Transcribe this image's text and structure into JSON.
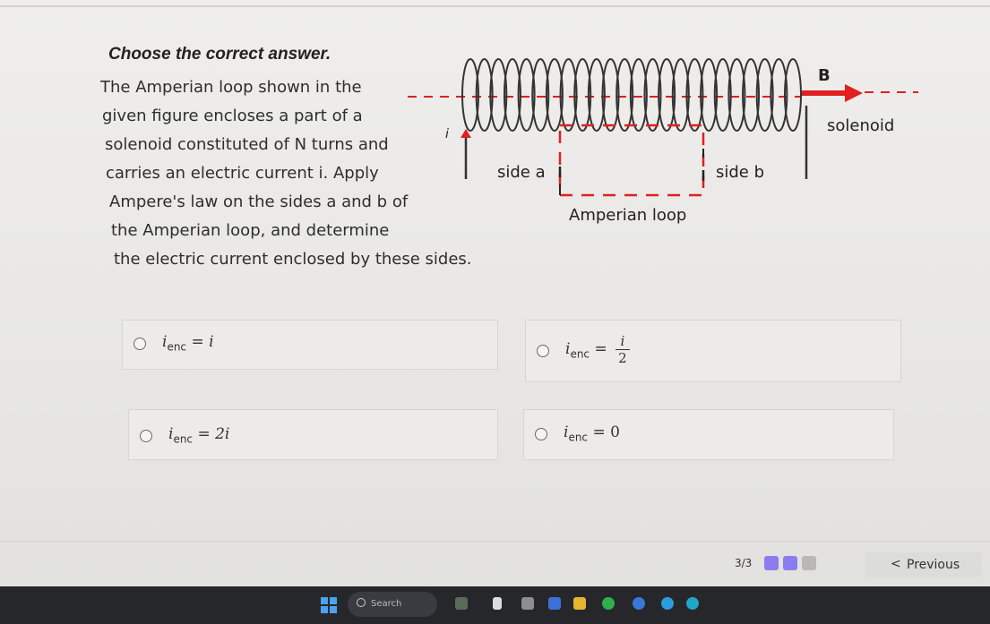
{
  "question": {
    "title": "Choose the correct answer.",
    "lines": [
      "The Amperian loop shown in the",
      "given figure encloses a part of a",
      "solenoid constituted of N turns and",
      "carries an electric current i. Apply",
      "Ampere's law on the sides a and b of",
      "the Amperian loop, and determine",
      "the electric current enclosed by these sides."
    ]
  },
  "figure": {
    "field_label": "B",
    "solenoid_label": "solenoid",
    "current_label": "i",
    "side_a_label": "side a",
    "side_b_label": "side b",
    "loop_label": "Amperian loop",
    "colors": {
      "coil": "#333333",
      "arrow": "#e02020",
      "loop": "#e02020",
      "field_line": "#e02020"
    }
  },
  "options": [
    {
      "sym": "i",
      "sub": "enc",
      "eq": "= i"
    },
    {
      "sym": "i",
      "sub": "enc",
      "eq": "=",
      "num": "i",
      "den": "2"
    },
    {
      "sym": "i",
      "sub": "enc",
      "eq": "= 2i"
    },
    {
      "sym": "i",
      "sub": "enc",
      "eq": "= 0"
    }
  ],
  "footer": {
    "progress_text": "3/3",
    "previous_label": "Previous",
    "previous_arrow": "<",
    "progress_colors": [
      "#8b7cf0",
      "#8b7cf0",
      "#b9b8b6"
    ]
  },
  "taskbar": {
    "search_placeholder": "Search"
  }
}
